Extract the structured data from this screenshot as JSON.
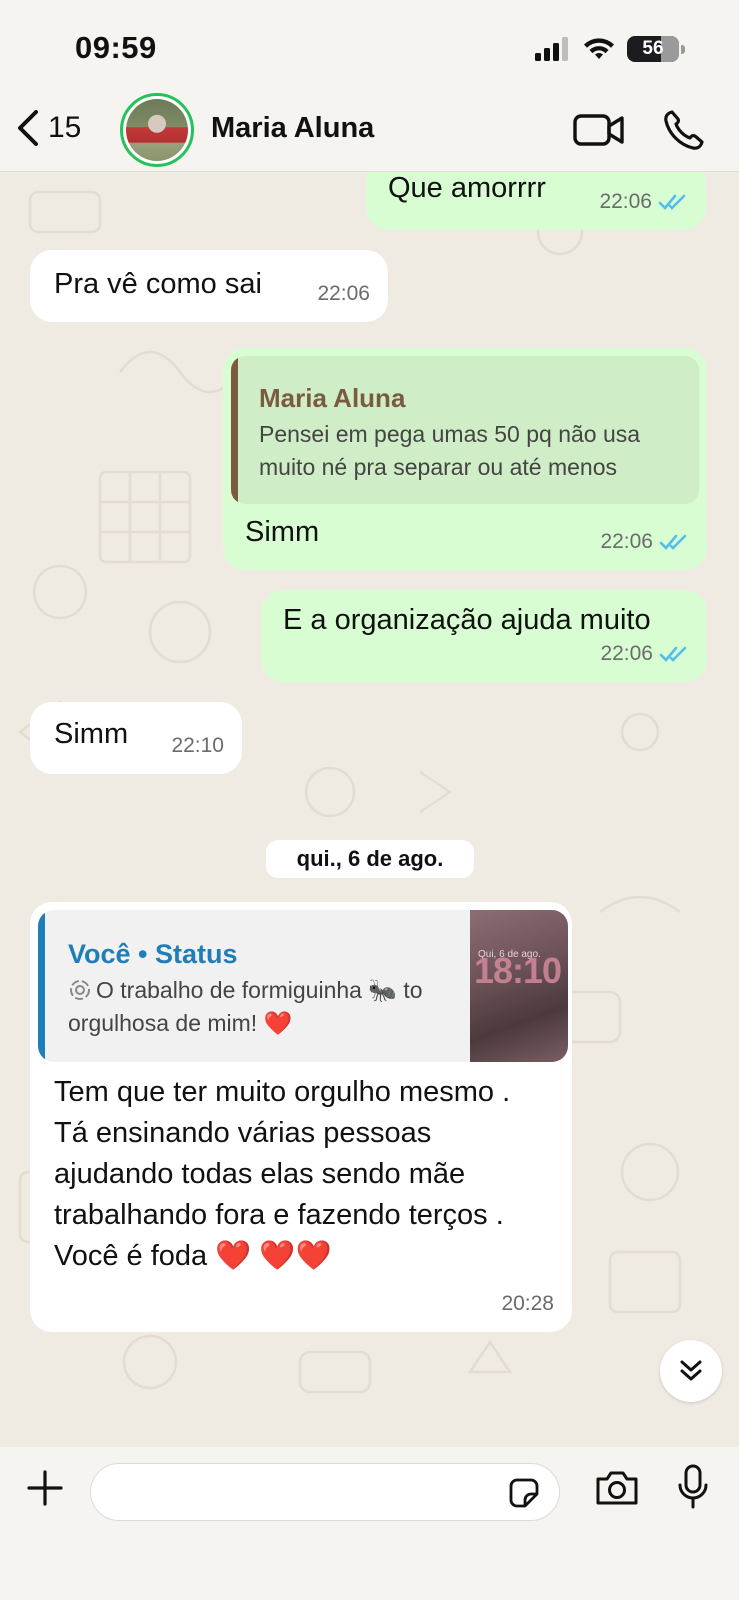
{
  "status_bar": {
    "time": "09:59",
    "battery": "56"
  },
  "header": {
    "back_count": "15",
    "contact_name": "Maria Aluna"
  },
  "messages": [
    {
      "dir": "out",
      "text": "Que amorrrr",
      "time": "22:06"
    },
    {
      "dir": "in",
      "text": "Pra vê como sai",
      "time": "22:06"
    },
    {
      "dir": "out",
      "text": "Simm",
      "time": "22:06",
      "quote": {
        "name": "Maria Aluna",
        "text": "Pensei em pega umas 50 pq não usa muito né pra separar ou até menos"
      }
    },
    {
      "dir": "out",
      "text": "E a organização ajuda muito",
      "time": "22:06"
    },
    {
      "dir": "in",
      "text": "Simm",
      "time": "22:10"
    }
  ],
  "date_separator": "qui., 6 de ago.",
  "status_reply": {
    "title": "Você • Status",
    "quote_text": "O trabalho de formiguinha 🐜 to orgulhosa de mim! ❤️",
    "thumb_time": "18:10",
    "thumb_date": "Qui, 6 de ago.",
    "text": "Tem que ter muito orgulho mesmo . Tá ensinando várias pessoas ajudando todas elas sendo mãe trabalhando fora e fazendo terços . Você é foda ❤️ ❤️❤️",
    "time": "20:28",
    "reaction": "❤️"
  },
  "composer": {
    "placeholder": ""
  },
  "colors": {
    "outgoing": "#d9fdd3",
    "incoming": "#ffffff",
    "read_ticks": "#53bdeb",
    "online_ring": "#25c25a"
  }
}
